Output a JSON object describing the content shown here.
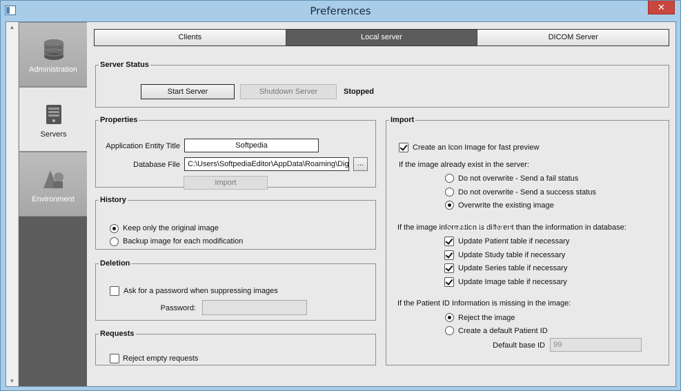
{
  "window": {
    "title": "Preferences",
    "close_glyph": "✕"
  },
  "nav": {
    "items": [
      {
        "label": "Administration",
        "icon": "database-icon",
        "active": false
      },
      {
        "label": "Servers",
        "icon": "server-icon",
        "active": true
      },
      {
        "label": "Environment",
        "icon": "shapes-icon",
        "active": false
      }
    ]
  },
  "tabs": {
    "clients": "Clients",
    "local_server": "Local server",
    "dicom_server": "DICOM Server"
  },
  "server_status": {
    "legend": "Server Status",
    "start_button": "Start Server",
    "shutdown_button": "Shutdown Server",
    "status": "Stopped"
  },
  "properties": {
    "legend": "Properties",
    "ae_title_label": "Application Entity Title",
    "ae_title_value": "Softpedia",
    "db_file_label": "Database File",
    "db_file_value": "C:\\Users\\SoftpediaEditor\\AppData\\Roaming\\Dig",
    "browse_button": "...",
    "import_button": "Import"
  },
  "history": {
    "legend": "History",
    "keep_original": "Keep only the original image",
    "backup_each": "Backup image for each modification"
  },
  "deletion": {
    "legend": "Deletion",
    "ask_password": "Ask for a password when suppressing images",
    "password_label": "Password:"
  },
  "requests": {
    "legend": "Requests",
    "reject_empty": "Reject empty requests"
  },
  "import": {
    "legend": "Import",
    "icon_image": "Create an Icon Image for fast preview",
    "exists_heading": "If the image already exist in the server:",
    "exists_fail": "Do not overwrite - Send a fail status",
    "exists_success": "Do not overwrite - Send a success status",
    "exists_overwrite": "Overwrite the existing image",
    "different_heading": "If the image information is different than the information in database:",
    "update_patient": "Update Patient table if necessary",
    "update_study": "Update Study table if necessary",
    "update_series": "Update Series table if necessary",
    "update_image": "Update Image table if necessary",
    "missing_heading": "If the Patient ID Information is missing in the image:",
    "reject_image": "Reject the image",
    "create_default": "Create a default Patient ID",
    "default_base_label": "Default base ID",
    "default_base_value": "99"
  },
  "watermark": "SOFTPEDIA",
  "colors": {
    "active_tab": "#5c5c5c",
    "panel": "#e9e9e9",
    "nav_bg": "#5d5d5d",
    "close": "#c7463d"
  }
}
